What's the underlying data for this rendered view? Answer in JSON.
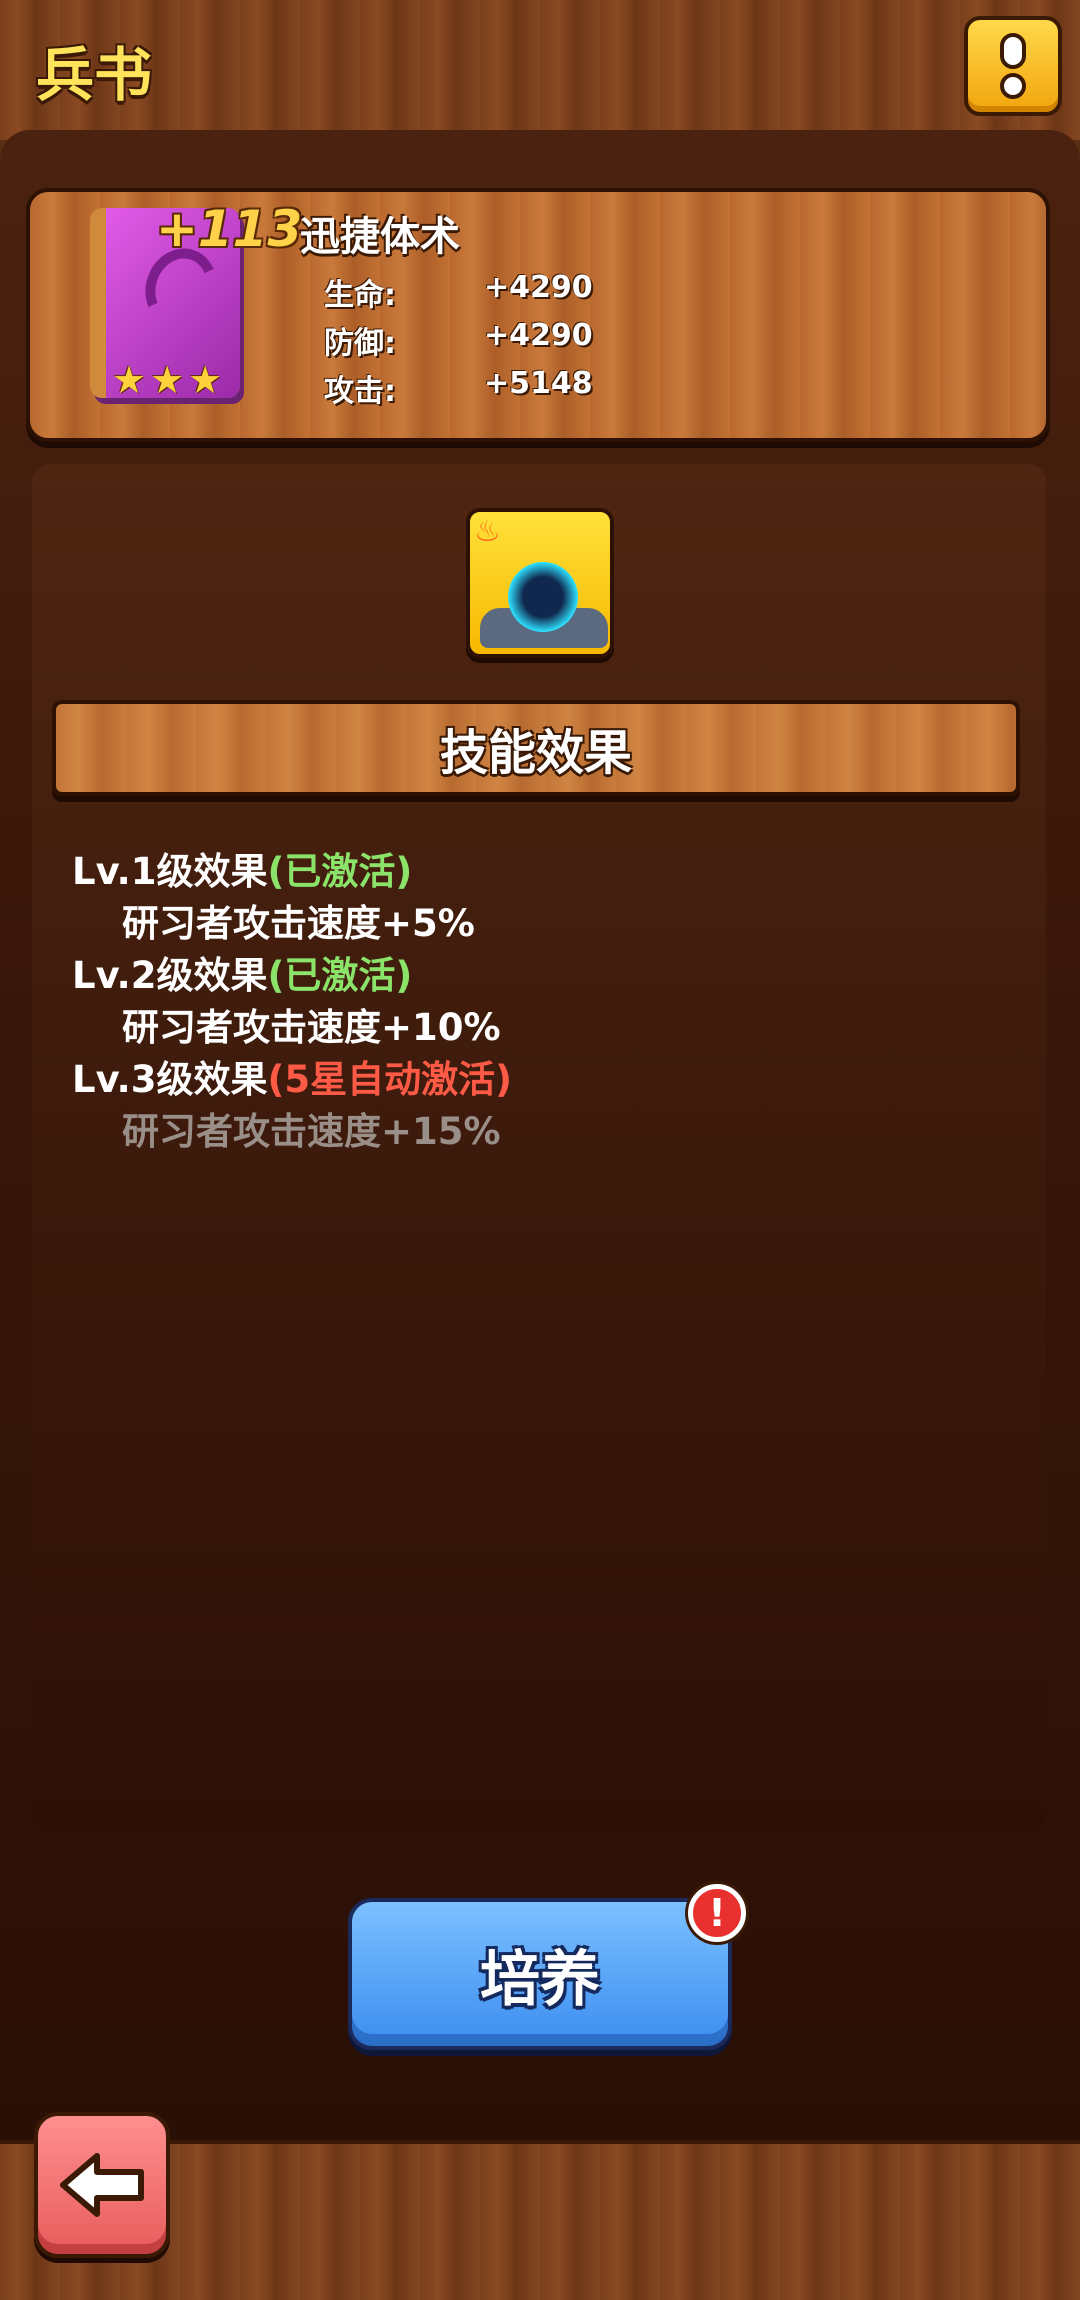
{
  "header": {
    "title": "兵书"
  },
  "book": {
    "plus_level": "+113",
    "name": "迅捷体术",
    "stars": 3,
    "stats": [
      {
        "label": "生命:",
        "value": "+4290"
      },
      {
        "label": "防御:",
        "value": "+4290"
      },
      {
        "label": "攻击:",
        "value": "+5148"
      }
    ]
  },
  "skill_section": {
    "title": "技能效果"
  },
  "effects": [
    {
      "level": "Lv.1级效果",
      "status": "(已激活)",
      "status_color": "green",
      "desc": "研习者攻击速度+5%",
      "active": true
    },
    {
      "level": "Lv.2级效果",
      "status": "(已激活)",
      "status_color": "green",
      "desc": "研习者攻击速度+10%",
      "active": true
    },
    {
      "level": "Lv.3级效果",
      "status": "(5星自动激活)",
      "status_color": "red",
      "desc": "研习者攻击速度+15%",
      "active": false
    }
  ],
  "actions": {
    "cultivate_label": "培养",
    "alert_badge": "!"
  },
  "colors": {
    "accent_yellow": "#ffe35a",
    "active_green": "#8be36a",
    "inactive_red": "#ff5a45",
    "button_blue": "#3b8df0"
  }
}
